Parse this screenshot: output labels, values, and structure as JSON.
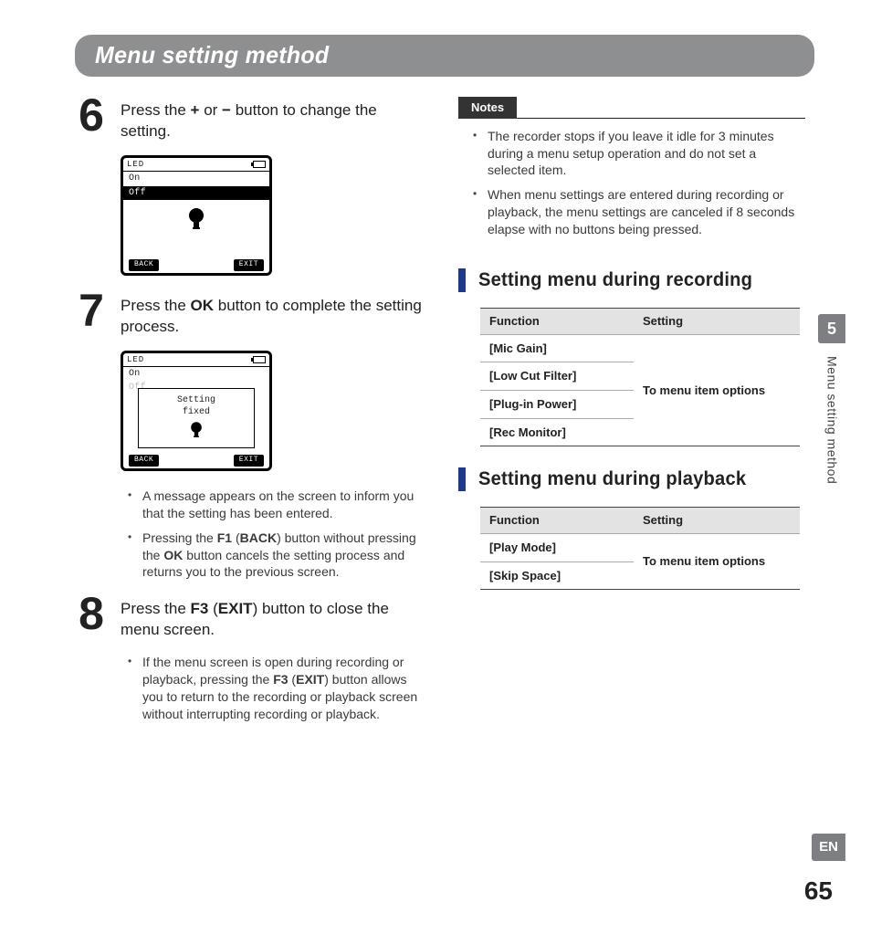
{
  "title": "Menu setting method",
  "steps": {
    "s6": {
      "num": "6",
      "text_a": "Press the ",
      "plus": "+",
      "or": " or ",
      "minus": "−",
      "text_b": " button to change the setting."
    },
    "s7": {
      "num": "7",
      "text_a": "Press the ",
      "ok": "OK",
      "text_b": " button to complete the setting process."
    },
    "s8": {
      "num": "8",
      "text_a": "Press the ",
      "f3": "F3",
      "paren_open": " (",
      "exit": "EXIT",
      "paren_close": ")",
      "text_b": " button to close the menu screen."
    }
  },
  "device1": {
    "title": "LED",
    "on": "On",
    "off": "Off",
    "back": "BACK",
    "exit": "EXIT"
  },
  "device2": {
    "title": "LED",
    "on": "On",
    "off": "Off",
    "popup1": "Setting",
    "popup2": "fixed",
    "back": "BACK",
    "exit": "EXIT"
  },
  "bullets7": [
    "A message appears on the screen to inform you that the setting has been entered.",
    "Pressing the <b>F1</b> (<b>BACK</b>) button without pressing the <b>OK</b> button cancels the setting process and returns you to the previous screen."
  ],
  "bullets8": [
    "If the menu screen is open during recording or playback, pressing the <b>F3</b> (<b>EXIT</b>) button allows you to return to the recording or playback screen without interrupting recording or playback."
  ],
  "notes_label": "Notes",
  "notes": [
    "The recorder stops if you leave it idle for 3 minutes during a menu setup operation and do not set a selected item.",
    "When menu settings are entered during recording or playback, the menu settings are canceled if 8 seconds elapse with no buttons being pressed."
  ],
  "sec_recording": "Setting menu during recording",
  "sec_playback": "Setting menu during playback",
  "table_headers": {
    "function": "Function",
    "setting": "Setting"
  },
  "table_recording": {
    "functions": [
      "[Mic Gain]",
      "[Low Cut Filter]",
      "[Plug-in Power]",
      "[Rec Monitor]"
    ],
    "setting": "To menu item options"
  },
  "table_playback": {
    "functions": [
      "[Play Mode]",
      "[Skip Space]"
    ],
    "setting": "To menu item options"
  },
  "side": {
    "chapter": "5",
    "label": "Menu setting method"
  },
  "lang": "EN",
  "pagenum": "65",
  "chart_data": null
}
